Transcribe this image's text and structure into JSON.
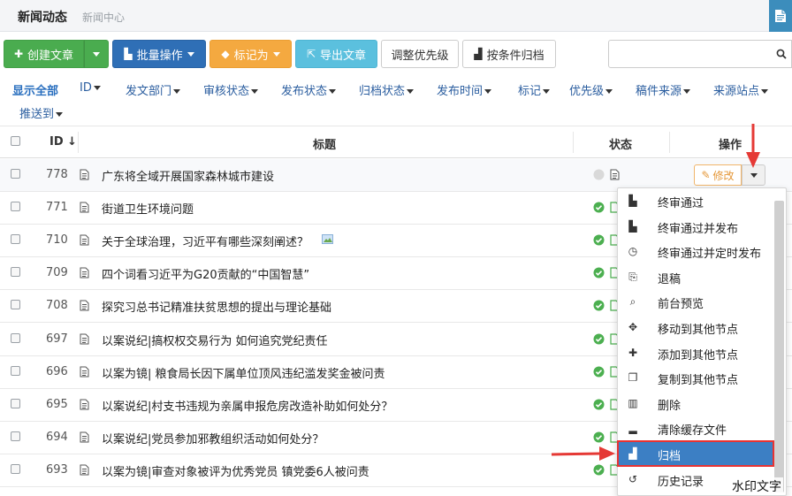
{
  "header": {
    "title": "新闻动态",
    "subtitle": "新闻中心"
  },
  "toolbar": {
    "create": "创建文章",
    "batch": "批量操作",
    "mark": "标记为",
    "export": "导出文章",
    "priority": "调整优先级",
    "archive_cond": "按条件归档"
  },
  "search": {
    "placeholder": ""
  },
  "filters": [
    "显示全部",
    "ID",
    "发文部门",
    "审核状态",
    "发布状态",
    "归档状态",
    "发布时间",
    "标记",
    "优先级",
    "稿件来源",
    "来源站点",
    "推送到"
  ],
  "table": {
    "headers": {
      "id": "ID",
      "title": "标题",
      "status": "状态",
      "action": "操作"
    },
    "rows": [
      {
        "id": "778",
        "title": "广东将全域开展国家森林城市建设"
      },
      {
        "id": "771",
        "title": "街道卫生环境问题"
      },
      {
        "id": "710",
        "title": "关于全球治理，习近平有哪些深刻阐述？"
      },
      {
        "id": "709",
        "title": "四个词看习近平为G20贡献的“中国智慧”"
      },
      {
        "id": "708",
        "title": "探究习总书记精准扶贫思想的提出与理论基础"
      },
      {
        "id": "697",
        "title": "以案说纪|搞权权交易行为 如何追究党纪责任"
      },
      {
        "id": "696",
        "title": "以案为镜| 粮食局长因下属单位顶风违纪滥发奖金被问责"
      },
      {
        "id": "695",
        "title": "以案说纪|村支书违规为亲属申报危房改造补助如何处分？"
      },
      {
        "id": "694",
        "title": "以案说纪|党员参加邪教组织活动如何处分？"
      },
      {
        "id": "693",
        "title": "以案为镜|审查对象被评为优秀党员 镇党委6人被问责"
      }
    ],
    "edit_label": "修改"
  },
  "menu": {
    "items": [
      {
        "label": "终审通过",
        "icon": "stamp-icon"
      },
      {
        "label": "终审通过并发布",
        "icon": "stamp-publish-icon"
      },
      {
        "label": "终审通过并定时发布",
        "icon": "clock-icon"
      },
      {
        "label": "退稿",
        "icon": "reject-icon"
      },
      {
        "label": "前台预览",
        "icon": "preview-icon"
      },
      {
        "label": "移动到其他节点",
        "icon": "move-icon"
      },
      {
        "label": "添加到其他节点",
        "icon": "plus-icon"
      },
      {
        "label": "复制到其他节点",
        "icon": "copy-icon"
      },
      {
        "label": "删除",
        "icon": "trash-icon"
      },
      {
        "label": "清除缓存文件",
        "icon": "broom-icon"
      },
      {
        "label": "归档",
        "icon": "archive-icon"
      },
      {
        "label": "历史记录",
        "icon": "history-icon"
      }
    ],
    "selected": "归档"
  },
  "watermark": "水印文字",
  "colors": {
    "accent": "#3c7fc4",
    "highlight": "#e83333",
    "success": "#4caf50"
  }
}
